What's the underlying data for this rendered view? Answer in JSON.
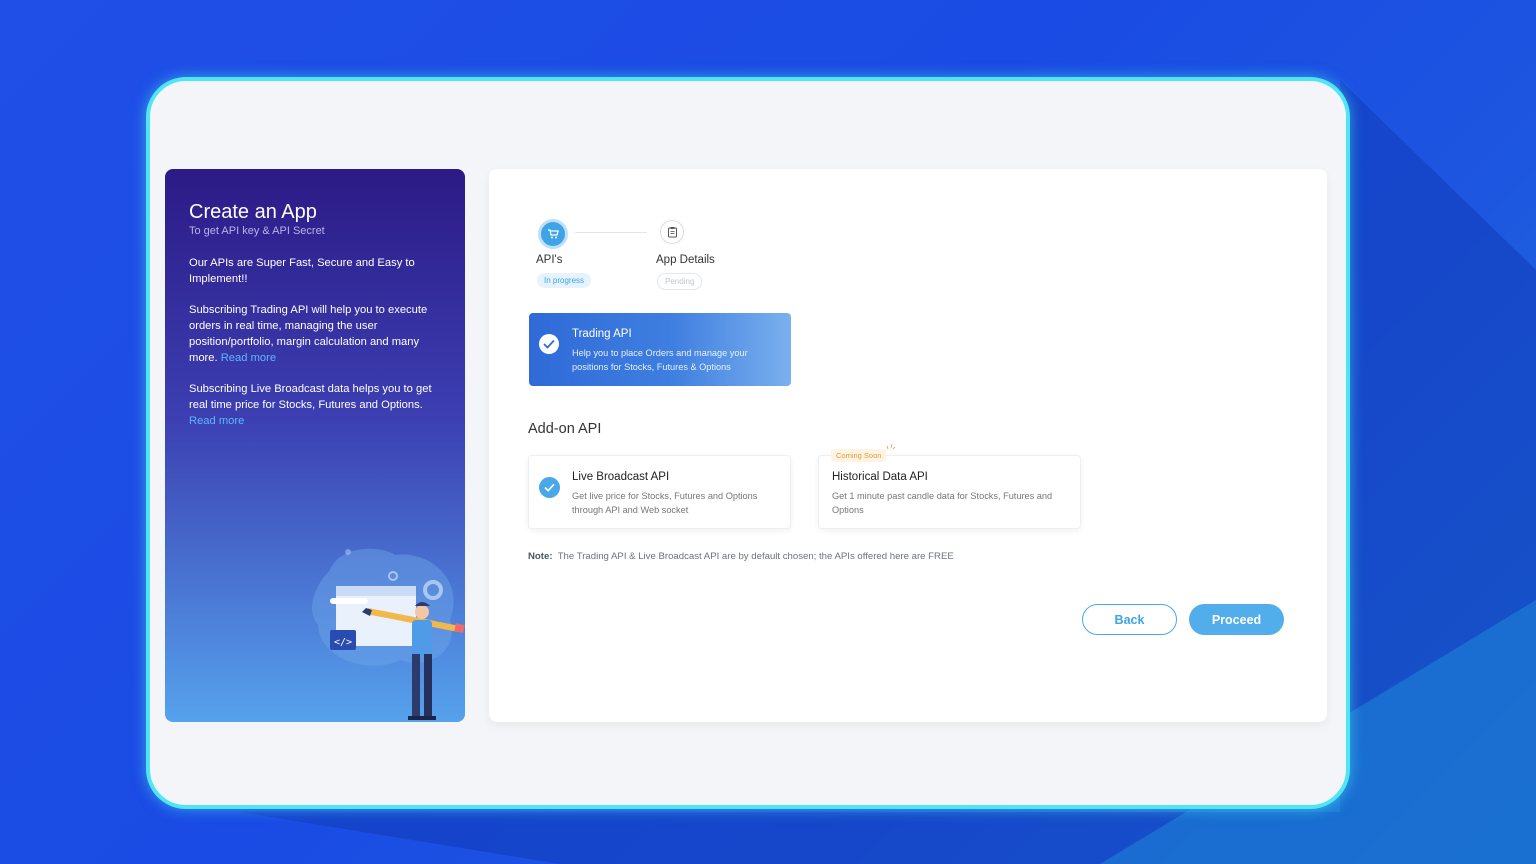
{
  "left_panel": {
    "title": "Create an App",
    "subtitle": "To get API key & API Secret",
    "para1": "Our APIs are Super Fast, Secure and Easy to Implement!!",
    "para2": "Subscribing Trading API will help you to execute orders in real time, managing the user position/portfolio, margin calculation and many more.",
    "para2_link": "Read more",
    "para3": "Subscribing Live Broadcast data helps you to get real time price for Stocks, Futures and Options.",
    "para3_link": "Read more"
  },
  "stepper": {
    "steps": [
      {
        "label": "API's",
        "status": "In progress",
        "icon": "cart-icon"
      },
      {
        "label": "App Details",
        "status": "Pending",
        "icon": "clipboard-icon"
      }
    ]
  },
  "trading_api": {
    "title": "Trading API",
    "description": "Help you to place Orders and manage your positions for Stocks, Futures & Options",
    "selected": true
  },
  "addon": {
    "heading": "Add-on API",
    "items": [
      {
        "title": "Live Broadcast API",
        "description": "Get live price for Stocks, Futures and Options through API and Web socket",
        "selected": true
      },
      {
        "title": "Historical Data API",
        "description": "Get 1 minute past candle data for Stocks, Futures and Options",
        "badge": "Coming Soon",
        "selected": false
      }
    ]
  },
  "note": {
    "label": "Note:",
    "text": "The Trading API & Live Broadcast API are by default chosen; the APIs offered here are FREE"
  },
  "actions": {
    "back": "Back",
    "proceed": "Proceed"
  },
  "colors": {
    "accent": "#3fa3e8",
    "frame_border": "#4de6f2",
    "background": "#1f4fe6"
  }
}
